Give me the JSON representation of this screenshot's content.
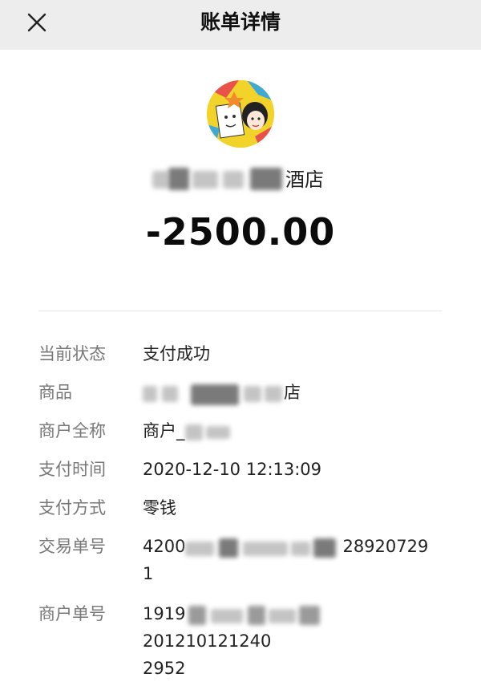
{
  "header": {
    "title": "账单详情"
  },
  "merchant": {
    "name_suffix": "酒店"
  },
  "amount": "-2500.00",
  "details": {
    "status": {
      "label": "当前状态",
      "value": "支付成功"
    },
    "product": {
      "label": "商品",
      "value_suffix": "店"
    },
    "merchant_full": {
      "label": "商户全称",
      "value_prefix": "商户_"
    },
    "pay_time": {
      "label": "支付时间",
      "value": "2020-12-10 12:13:09"
    },
    "pay_method": {
      "label": "支付方式",
      "value": "零钱"
    },
    "transaction_no": {
      "label": "交易单号",
      "value_start": "4200",
      "value_end_line1": "28920729",
      "value_line2": "1"
    },
    "merchant_no": {
      "label": "商户单号",
      "value_start": "1919",
      "value_end_line1": "201210121240",
      "value_line2": "2952"
    }
  }
}
